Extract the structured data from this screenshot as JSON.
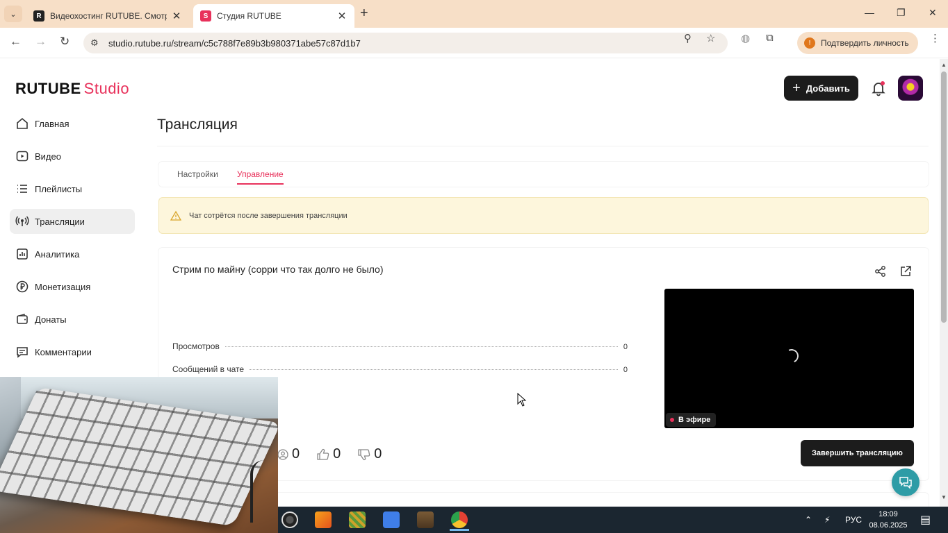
{
  "browser": {
    "tabs": [
      {
        "title": "Видеохостинг RUTUBE. Смотри…",
        "favicon": "rutube-favicon",
        "active": false
      },
      {
        "title": "Студия RUTUBE",
        "favicon": "studio-favicon",
        "active": true
      }
    ],
    "url": "studio.rutube.ru/stream/c5c788f7e89b3b980371abe57c87d1b7",
    "verify_label": "Подтвердить личность"
  },
  "header": {
    "logo_main": "RUTUBE",
    "logo_sub": "Studio",
    "add_label": "Добавить"
  },
  "sidebar": {
    "items": [
      {
        "label": "Главная",
        "icon": "home-icon"
      },
      {
        "label": "Видео",
        "icon": "video-icon"
      },
      {
        "label": "Плейлисты",
        "icon": "playlist-icon"
      },
      {
        "label": "Трансляции",
        "icon": "broadcast-icon",
        "active": true
      },
      {
        "label": "Аналитика",
        "icon": "analytics-icon"
      },
      {
        "label": "Монетизация",
        "icon": "ruble-icon"
      },
      {
        "label": "Донаты",
        "icon": "wallet-icon"
      },
      {
        "label": "Комментарии",
        "icon": "comment-icon"
      }
    ]
  },
  "main": {
    "page_title": "Трансляция",
    "tabs": [
      {
        "label": "Настройки",
        "active": false
      },
      {
        "label": "Управление",
        "active": true
      }
    ],
    "warning": "Чат сотрётся после завершения трансляции",
    "stream": {
      "title": "Стрим по майну (сорри что так долго не было)",
      "stats": [
        {
          "label": "Просмотров",
          "value": "0"
        },
        {
          "label": "Сообщений в чате",
          "value": "0"
        }
      ],
      "live_badge": "В эфире",
      "counters": {
        "viewers": "0",
        "likes": "0",
        "dislikes": "0"
      },
      "end_button": "Завершить трансляцию"
    }
  },
  "taskbar": {
    "language": "РУС",
    "time": "18:09",
    "date": "08.06.2025",
    "apps": [
      "obs-icon",
      "fl-studio-icon",
      "minecraft-launcher-icon",
      "roblox-icon",
      "minecraft-icon",
      "chrome-icon"
    ]
  },
  "colors": {
    "accent": "#e8315b",
    "tabbar": "#f7dfc7",
    "dark_button": "#1c1c1c",
    "warning_bg": "#fdf6dc",
    "taskbar": "#1b2630",
    "chat_fab": "#2e9ca6"
  }
}
